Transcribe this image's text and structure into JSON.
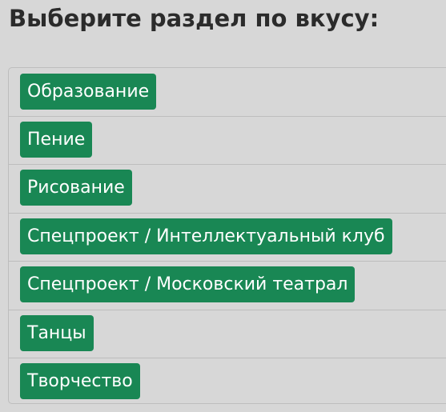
{
  "page": {
    "title": "Выберите раздел по вкусу:"
  },
  "sections": [
    {
      "label": "Образование"
    },
    {
      "label": "Пение"
    },
    {
      "label": "Рисование"
    },
    {
      "label": "Спецпроект / Интеллектуальный клуб"
    },
    {
      "label": "Спецпроект / Московский театрал"
    },
    {
      "label": "Танцы"
    },
    {
      "label": "Творчество"
    }
  ],
  "colors": {
    "background": "#d7d7d7",
    "chip": "#198754",
    "chip_text": "#ffffff",
    "title": "#2b2b2b",
    "divider": "#bdbdbd"
  }
}
